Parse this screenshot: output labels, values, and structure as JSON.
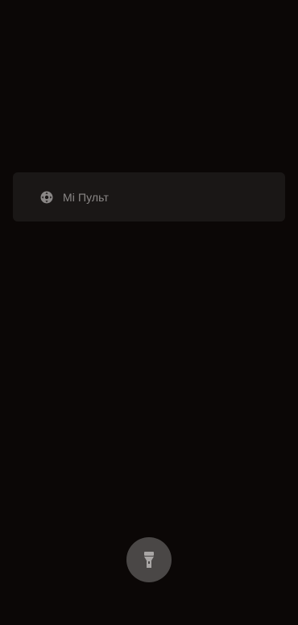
{
  "shortcuts": [
    {
      "label": "Mi Пульт",
      "icon": "remote-control-icon"
    }
  ],
  "flashlight": {
    "icon": "flashlight-icon"
  },
  "colors": {
    "background": "#0b0706",
    "card": "#1a1716",
    "label": "#8a8786",
    "fab": "#4a4746"
  }
}
